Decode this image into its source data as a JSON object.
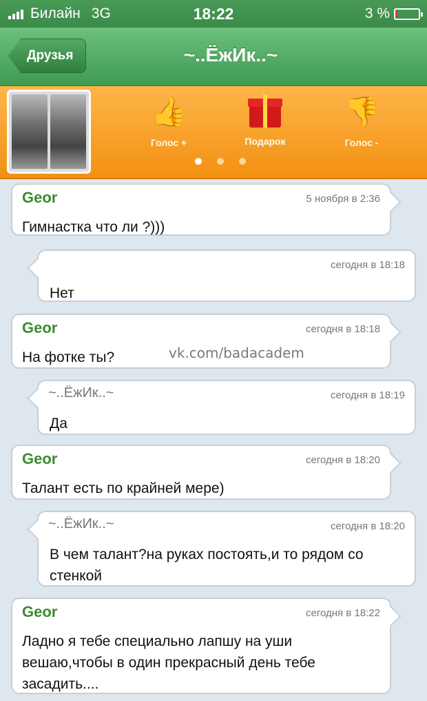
{
  "status": {
    "carrier": "Билайн",
    "network": "3G",
    "time": "18:22",
    "battery": "3 %"
  },
  "nav": {
    "back_label": "Друзья",
    "title": "~..ЁжИк..~"
  },
  "actions": [
    {
      "label": "Голос +",
      "icon": "thumbs-up-icon"
    },
    {
      "label": "Подарок",
      "icon": "gift-icon"
    },
    {
      "label": "Голос -",
      "icon": "thumbs-down-icon"
    }
  ],
  "pager": {
    "pages": 3,
    "current": 1
  },
  "messages": [
    {
      "sender": "Geor",
      "time": "5 ноября в 2:36",
      "text": "Гимнастка что ли ?)))"
    },
    {
      "sender": "",
      "time": "сегодня в 18:18",
      "text": "Нет"
    },
    {
      "sender": "Geor",
      "time": "сегодня в 18:18",
      "text": "На фотке ты?"
    },
    {
      "sender": "~..ЁжИк..~",
      "time": "сегодня в 18:19",
      "text": "Да"
    },
    {
      "sender": "Geor",
      "time": "сегодня в 18:20",
      "text": "Талант есть по крайней мере)"
    },
    {
      "sender": "~..ЁжИк..~",
      "time": "сегодня в 18:20",
      "text": "В чем талант?на руках постоять,и то рядом со стенкой"
    },
    {
      "sender": "Geor",
      "time": "сегодня в 18:22",
      "text": "Ладно я тебе специально лапшу на уши вешаю,чтобы в один прекрасный день тебе засадить...."
    }
  ],
  "watermark": "vk.com/badacadem",
  "colors": {
    "statusbar": "#3a8a48",
    "navbar": "#4fae61",
    "actionbar": "#f7a030",
    "sender": "#3d8b2e",
    "background": "#dfe7ee"
  }
}
